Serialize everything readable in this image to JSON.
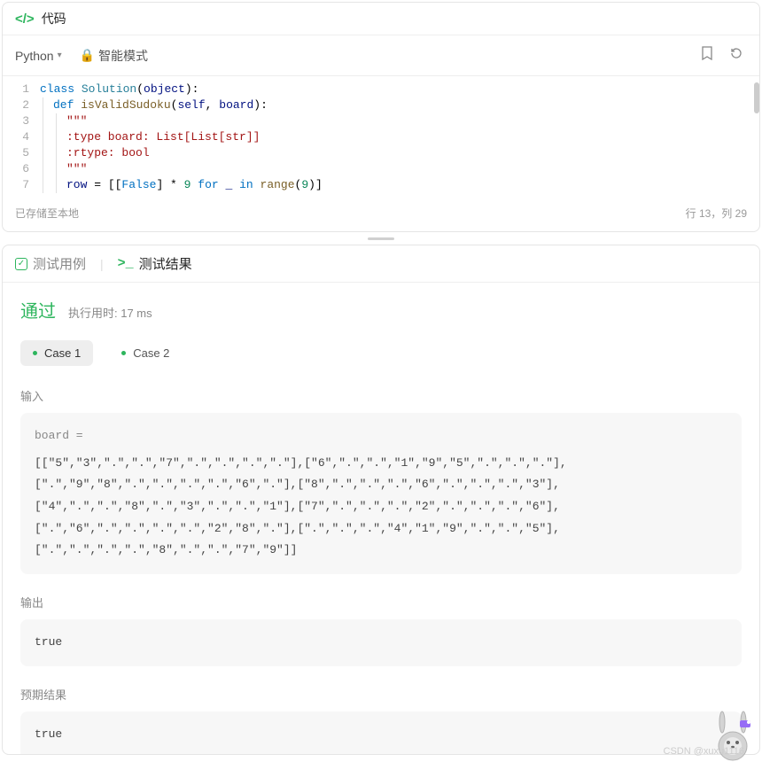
{
  "code_section": {
    "title": "代码",
    "language": "Python",
    "mode_label": "智能模式",
    "status_saved": "已存储至本地",
    "cursor_pos": "行 13，列 29",
    "lines": [
      {
        "n": 1,
        "tokens": [
          [
            "kw",
            "class "
          ],
          [
            "cls",
            "Solution"
          ],
          [
            "op",
            "("
          ],
          [
            "nm",
            "object"
          ],
          [
            "op",
            ")"
          ],
          [
            "op",
            ":"
          ]
        ]
      },
      {
        "n": 2,
        "indent": 1,
        "tokens": [
          [
            "kw",
            "def "
          ],
          [
            "fn",
            "isValidSudoku"
          ],
          [
            "op",
            "("
          ],
          [
            "nm",
            "self"
          ],
          [
            "op",
            ", "
          ],
          [
            "nm",
            "board"
          ],
          [
            "op",
            ")"
          ],
          [
            "op",
            ":"
          ]
        ]
      },
      {
        "n": 3,
        "indent": 2,
        "tokens": [
          [
            "str",
            "\"\"\""
          ]
        ]
      },
      {
        "n": 4,
        "indent": 2,
        "tokens": [
          [
            "str",
            ":type board: List[List[str]]"
          ]
        ]
      },
      {
        "n": 5,
        "indent": 2,
        "tokens": [
          [
            "str",
            ":rtype: bool"
          ]
        ]
      },
      {
        "n": 6,
        "indent": 2,
        "tokens": [
          [
            "str",
            "\"\"\""
          ]
        ]
      },
      {
        "n": 7,
        "indent": 2,
        "tokens": [
          [
            "nm",
            "row"
          ],
          [
            "op",
            " = "
          ],
          [
            "op",
            "[["
          ],
          [
            "kw",
            "False"
          ],
          [
            "op",
            "] * "
          ],
          [
            "num",
            "9"
          ],
          [
            "kw",
            " for "
          ],
          [
            "nm",
            "_"
          ],
          [
            "kw",
            " in "
          ],
          [
            "fn",
            "range"
          ],
          [
            "op",
            "("
          ],
          [
            "num",
            "9"
          ],
          [
            "op",
            ")]"
          ]
        ]
      }
    ]
  },
  "tabs": {
    "testcase": "测试用例",
    "testresult": "测试结果"
  },
  "result": {
    "verdict": "通过",
    "runtime_label": "执行用时: 17 ms",
    "cases": [
      {
        "label": "Case 1",
        "active": true
      },
      {
        "label": "Case 2",
        "active": false
      }
    ],
    "sections": {
      "input_label": "输入",
      "input_var": "board =",
      "input_value": "[[\"5\",\"3\",\".\",\".\",\"7\",\".\",\".\",\".\",\".\"],[\"6\",\".\",\".\",\"1\",\"9\",\"5\",\".\",\".\",\".\"],[\".\",\"9\",\"8\",\".\",\".\",\".\",\".\",\"6\",\".\"],[\"8\",\".\",\".\",\".\",\"6\",\".\",\".\",\".\",\"3\"],[\"4\",\".\",\".\",\"8\",\".\",\"3\",\".\",\".\",\"1\"],[\"7\",\".\",\".\",\".\",\"2\",\".\",\".\",\".\",\"6\"],[\".\",\"6\",\".\",\".\",\".\",\".\",\"2\",\"8\",\".\"],[\".\",\".\",\".\",\"4\",\"1\",\"9\",\".\",\".\",\"5\"],[\".\",\".\",\".\",\".\",\"8\",\".\",\".\",\"7\",\"9\"]]",
      "output_label": "输出",
      "output_value": "true",
      "expected_label": "预期结果",
      "expected_value": "true"
    }
  },
  "watermark": "CSDN @xuxu1116"
}
